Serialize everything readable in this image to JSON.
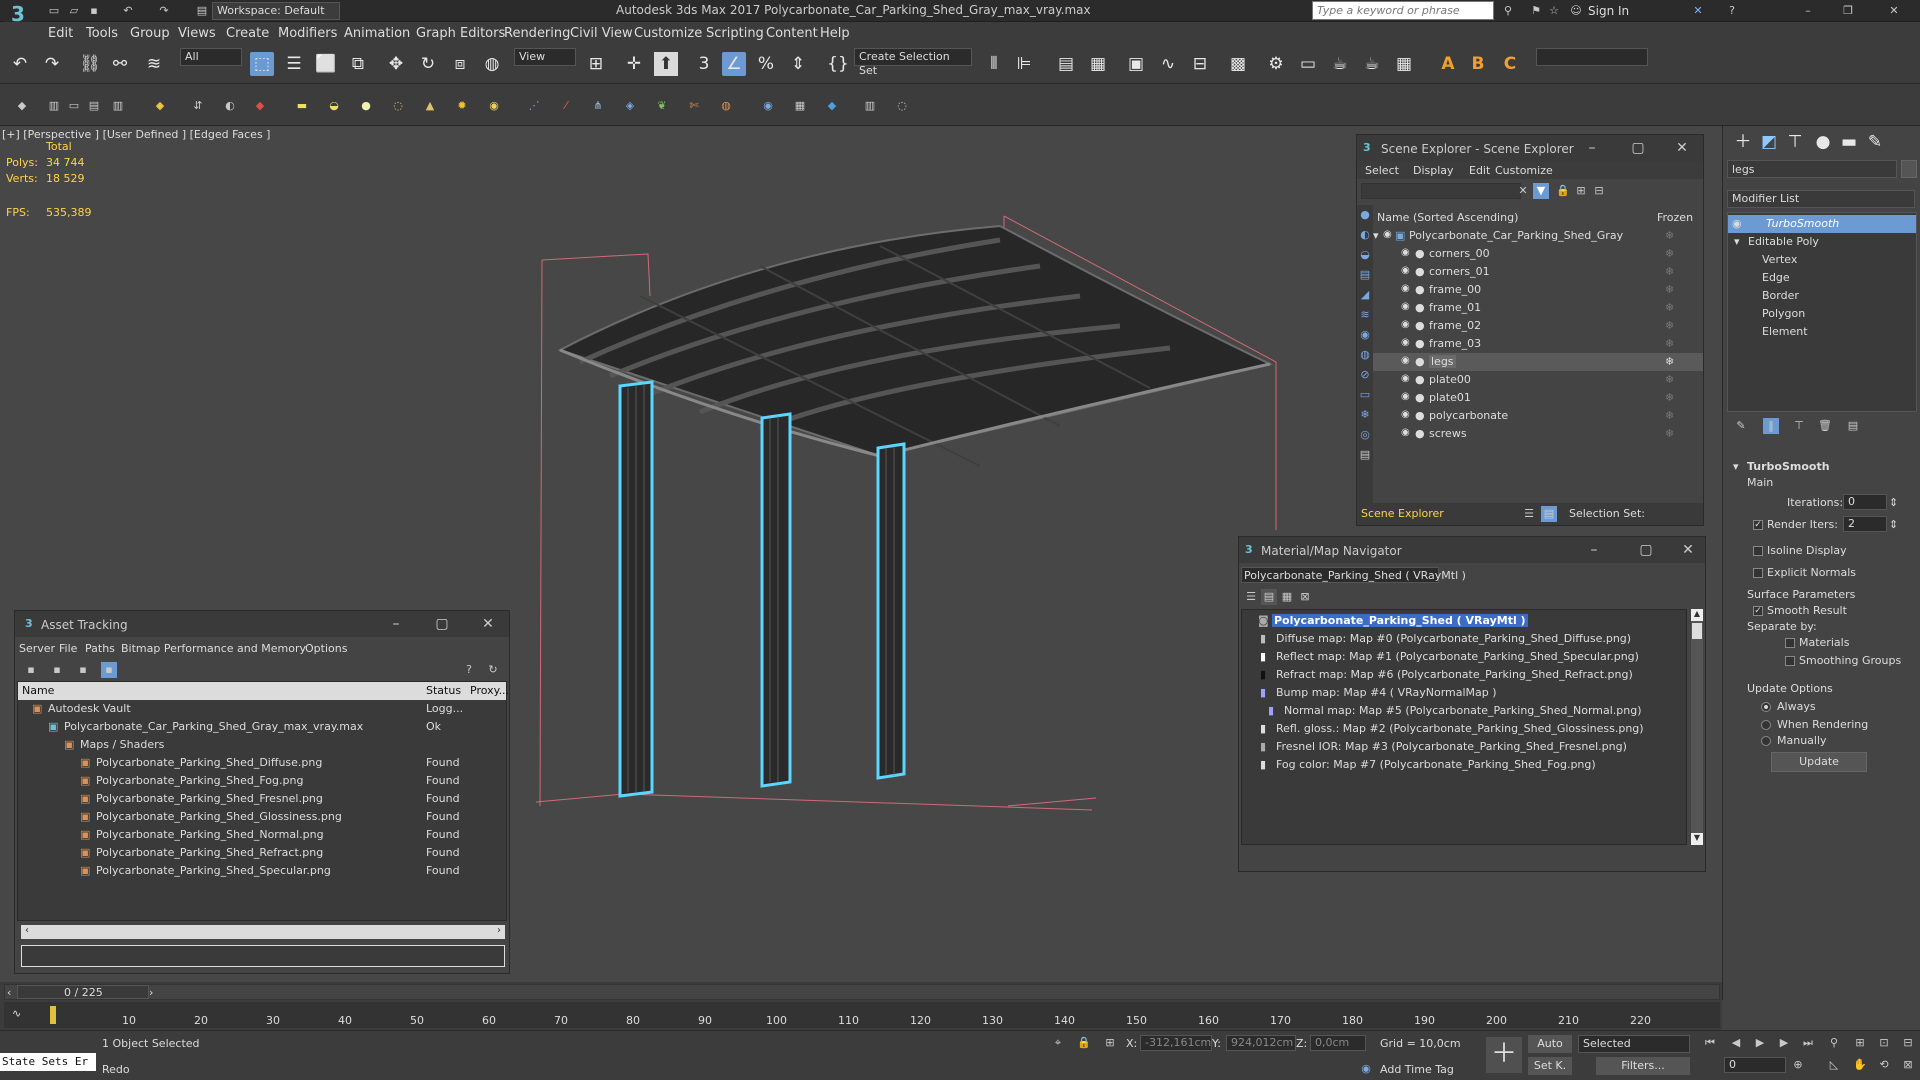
{
  "titlebar": {
    "workspace": "Workspace: Default",
    "title": "Autodesk 3ds Max 2017     Polycarbonate_Car_Parking_Shed_Gray_max_vray.max",
    "search_placeholder": "Type a keyword or phrase",
    "signin": "Sign In"
  },
  "menus": [
    "Edit",
    "Tools",
    "Group",
    "Views",
    "Create",
    "Modifiers",
    "Animation",
    "Graph Editors",
    "Rendering",
    "Civil View",
    "Customize",
    "Scripting",
    "Content",
    "Help"
  ],
  "toolbar": {
    "filter": "All",
    "view": "View",
    "selection_set": "Create Selection Set"
  },
  "viewport": {
    "label": "[+] [Perspective ]  [User Defined ]  [Edged Faces ]",
    "total": "Total",
    "polys_label": "Polys:",
    "polys_value": "34 744",
    "verts_label": "Verts:",
    "verts_value": "18 529",
    "fps_label": "FPS:",
    "fps_value": "535,389"
  },
  "scene_explorer": {
    "title": "Scene Explorer - Scene Explorer",
    "menus": [
      "Select",
      "Display",
      "Edit",
      "Customize"
    ],
    "col_name": "Name (Sorted Ascending)",
    "col_frozen": "Frozen",
    "root": "Polycarbonate_Car_Parking_Shed_Gray",
    "items": [
      "corners_00",
      "corners_01",
      "frame_00",
      "frame_01",
      "frame_02",
      "frame_03",
      "legs",
      "plate00",
      "plate01",
      "polycarbonate",
      "screws"
    ],
    "footer": "Scene Explorer",
    "selection_set": "Selection Set:"
  },
  "material_nav": {
    "title": "Material/Map Navigator",
    "current": "Polycarbonate_Parking_Shed  ( VRayMtl )",
    "root": "Polycarbonate_Parking_Shed  ( VRayMtl )",
    "maps": [
      "Diffuse map: Map #0 (Polycarbonate_Parking_Shed_Diffuse.png)",
      "Reflect map: Map #1 (Polycarbonate_Parking_Shed_Specular.png)",
      "Refract map: Map #6 (Polycarbonate_Parking_Shed_Refract.png)",
      "Bump map: Map #4  ( VRayNormalMap )",
      "Normal map: Map #5 (Polycarbonate_Parking_Shed_Normal.png)",
      "Refl. gloss.: Map #2 (Polycarbonate_Parking_Shed_Glossiness.png)",
      "Fresnel IOR: Map #3 (Polycarbonate_Parking_Shed_Fresnel.png)",
      "Fog color: Map #7 (Polycarbonate_Parking_Shed_Fog.png)"
    ]
  },
  "asset_tracking": {
    "title": "Asset Tracking",
    "menus": [
      "Server",
      "File",
      "Paths",
      "Bitmap Performance and Memory",
      "Options"
    ],
    "col_name": "Name",
    "col_status": "Status",
    "col_proxy": "Proxy...",
    "rows": [
      {
        "name": "Autodesk Vault",
        "status": "Logg..."
      },
      {
        "name": "Polycarbonate_Car_Parking_Shed_Gray_max_vray.max",
        "status": "Ok"
      },
      {
        "name": "Maps / Shaders",
        "status": ""
      },
      {
        "name": "Polycarbonate_Parking_Shed_Diffuse.png",
        "status": "Found"
      },
      {
        "name": "Polycarbonate_Parking_Shed_Fog.png",
        "status": "Found"
      },
      {
        "name": "Polycarbonate_Parking_Shed_Fresnel.png",
        "status": "Found"
      },
      {
        "name": "Polycarbonate_Parking_Shed_Glossiness.png",
        "status": "Found"
      },
      {
        "name": "Polycarbonate_Parking_Shed_Normal.png",
        "status": "Found"
      },
      {
        "name": "Polycarbonate_Parking_Shed_Refract.png",
        "status": "Found"
      },
      {
        "name": "Polycarbonate_Parking_Shed_Specular.png",
        "status": "Found"
      }
    ]
  },
  "command_panel": {
    "object_name": "legs",
    "modifier_list": "Modifier List",
    "stack": [
      "TurboSmooth",
      "Editable Poly",
      "Vertex",
      "Edge",
      "Border",
      "Polygon",
      "Element"
    ],
    "turbosmooth": "TurboSmooth",
    "main": "Main",
    "iterations_label": "Iterations:",
    "iterations_value": "0",
    "render_iters_label": "Render Iters:",
    "render_iters_value": "2",
    "isoline": "Isoline Display",
    "explicit_normals": "Explicit Normals",
    "surface_params": "Surface Parameters",
    "smooth_result": "Smooth Result",
    "separate_by": "Separate by:",
    "materials": "Materials",
    "smoothing_groups": "Smoothing Groups",
    "update_options": "Update Options",
    "always": "Always",
    "when_rendering": "When Rendering",
    "manually": "Manually",
    "update": "Update"
  },
  "timeline": {
    "frame": "0 / 225",
    "ticks": [
      "0",
      "10",
      "20",
      "30",
      "40",
      "50",
      "60",
      "70",
      "80",
      "90",
      "100",
      "110",
      "120",
      "130",
      "140",
      "150",
      "160",
      "170",
      "180",
      "190",
      "200",
      "210",
      "220"
    ]
  },
  "status": {
    "state_sets": "State Sets Er",
    "selected": "1 Object Selected",
    "prompt": "Redo",
    "x_label": "X:",
    "x_value": "-312,161cm",
    "y_label": "Y:",
    "y_value": "924,012cm",
    "z_label": "Z:",
    "z_value": "0,0cm",
    "grid": "Grid = 10,0cm",
    "add_time_tag": "Add Time Tag",
    "auto": "Auto",
    "set_key": "Set K.",
    "selected_dd": "Selected",
    "filters": "Filters...",
    "frame_field": "0"
  },
  "colors": {
    "accent": "#6c9bd4",
    "selection": "#5ad6ff",
    "stats": "#ffd24d"
  }
}
